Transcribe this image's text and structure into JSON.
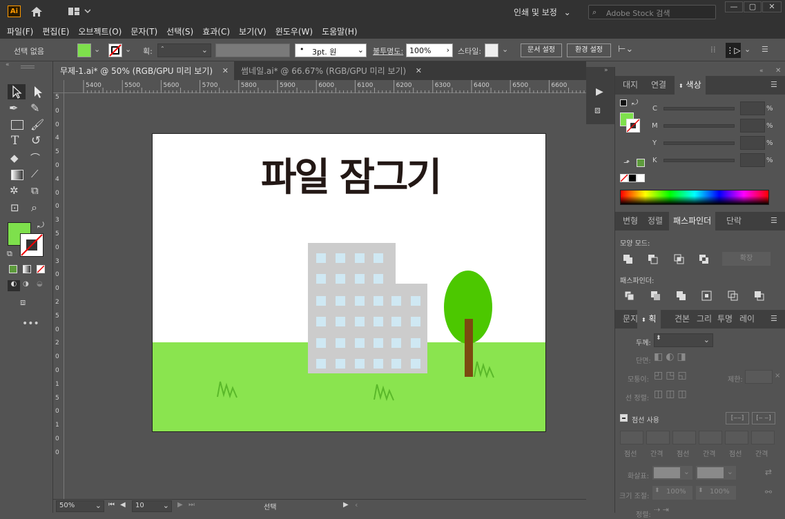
{
  "app": {
    "logo_text": "Ai",
    "workspace": "인쇄 및 보정",
    "search_placeholder": "Adobe Stock 검색"
  },
  "menu": [
    "파일(F)",
    "편집(E)",
    "오브젝트(O)",
    "문자(T)",
    "선택(S)",
    "효과(C)",
    "보기(V)",
    "윈도우(W)",
    "도움말(H)"
  ],
  "control": {
    "selection": "선택 없음",
    "stroke_label": "획:",
    "brush": "3pt. 원",
    "opacity_label": "불투명도:",
    "opacity": "100%",
    "style_label": "스타일:",
    "doc_setup": "문서 설정",
    "prefs": "환경 설정"
  },
  "tabs": [
    {
      "label": "무제-1.ai* @ 50% (RGB/GPU 미리 보기)"
    },
    {
      "label": "썸네일.ai* @ 66.67% (RGB/GPU 미리 보기)"
    }
  ],
  "ruler": [
    "5400",
    "5500",
    "5600",
    "5700",
    "5800",
    "5900",
    "6000",
    "6100",
    "6200",
    "6300",
    "6400",
    "6500",
    "6600"
  ],
  "ruler_v": [
    "5",
    "0",
    "0",
    "4",
    "5",
    "0",
    "4",
    "0",
    "0",
    "3",
    "5",
    "0",
    "3",
    "0",
    "0",
    "2",
    "5",
    "0",
    "2",
    "0",
    "0",
    "1",
    "5",
    "0",
    "1",
    "0",
    "0"
  ],
  "artwork": {
    "title": "파일 잠그기"
  },
  "status": {
    "zoom": "50%",
    "page": "10",
    "mode": "선택"
  },
  "color_panel": {
    "tabs": [
      "대지",
      "연결",
      "색상"
    ],
    "channels": [
      "C",
      "M",
      "Y",
      "K"
    ],
    "percent": "%"
  },
  "pathfinder_panel": {
    "tabs": [
      "변형",
      "정렬",
      "패스파인더",
      "단락"
    ],
    "shape_modes": "모양 모드:",
    "expand": "확장",
    "pathfinders": "패스파인더:"
  },
  "stroke_panel": {
    "tabs": [
      "문지",
      "획",
      "견본",
      "그리",
      "투명",
      "레이"
    ],
    "weight": "두께:",
    "cap": "단면:",
    "corner": "모퉁이:",
    "limit": "제한:",
    "align": "선 정렬:",
    "dashed": "점선 사용",
    "dash_labels": [
      "점선",
      "간격",
      "점선",
      "간격",
      "점선",
      "간격"
    ],
    "arrow": "화살표:",
    "scale": "크기 조절:",
    "scale1": "100%",
    "scale2": "100%",
    "align_bottom": "정렬:"
  },
  "colors": {
    "fill": "#7ee04c",
    "grass": "#8ae44f",
    "building": "#cccccc",
    "window": "#cfe8f3",
    "tree": "#4cc800",
    "trunk": "#7b4a10",
    "title": "#231815"
  }
}
